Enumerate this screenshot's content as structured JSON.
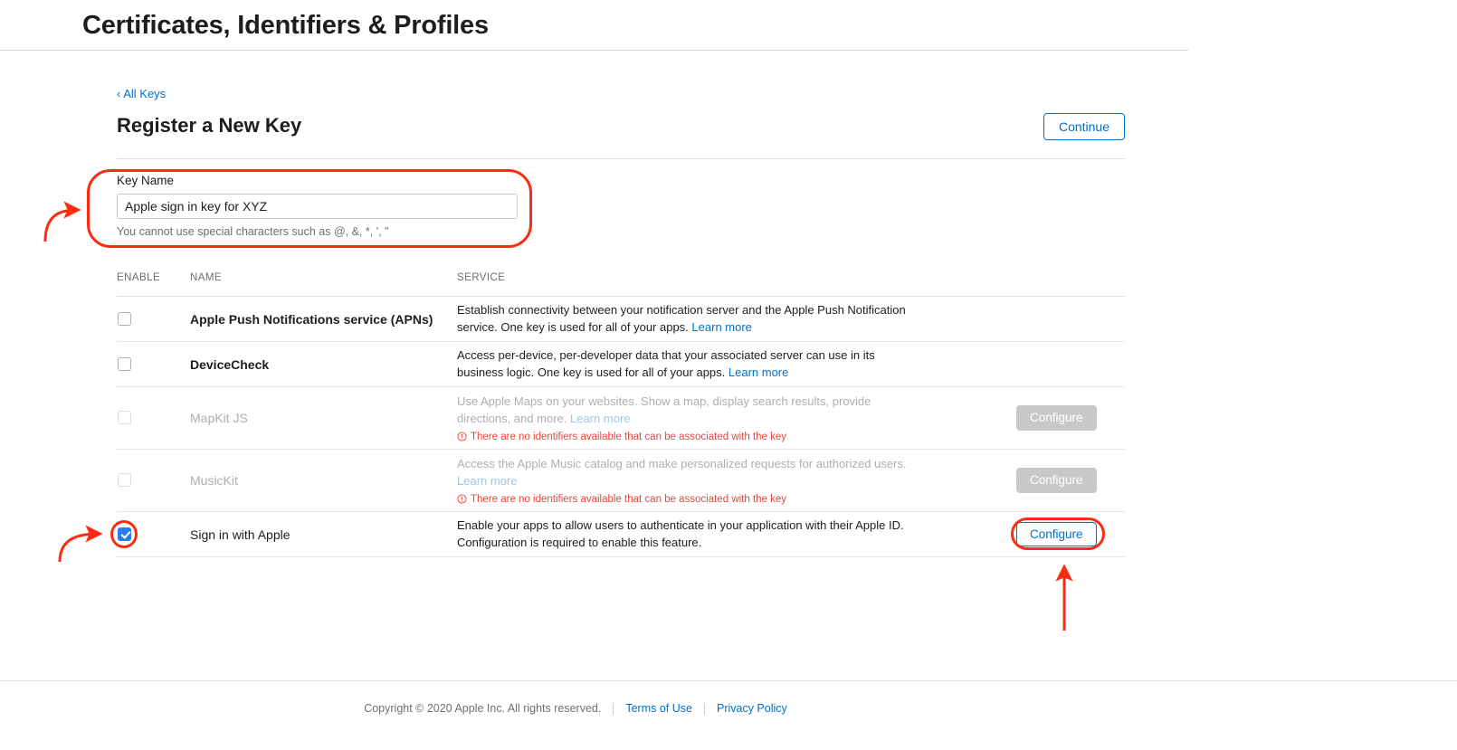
{
  "header": {
    "title": "Certificates, Identifiers & Profiles"
  },
  "breadcrumb": {
    "back_label": "‹ All Keys"
  },
  "section": {
    "title": "Register a New Key",
    "continue_label": "Continue"
  },
  "key_name": {
    "label": "Key Name",
    "value": "Apple sign in key for XYZ",
    "placeholder": "",
    "hint": "You cannot use special characters such as @, &, *, ', \""
  },
  "table": {
    "columns": {
      "enable": "ENABLE",
      "name": "NAME",
      "service": "SERVICE"
    },
    "rows": [
      {
        "name": "Apple Push Notifications service (APNs)",
        "desc": "Establish connectivity between your notification server and the Apple Push Notification service. One key is used for all of your apps.",
        "link": "Learn more",
        "warning": "",
        "action": "",
        "checked": false,
        "disabled": false
      },
      {
        "name": "DeviceCheck",
        "desc": "Access per-device, per-developer data that your associated server can use in its business logic. One key is used for all of your apps.",
        "link": "Learn more",
        "warning": "",
        "action": "",
        "checked": false,
        "disabled": false
      },
      {
        "name": "MapKit JS",
        "desc": "Use Apple Maps on your websites. Show a map, display search results, provide directions, and more.",
        "link": "Learn more",
        "warning": "There are no identifiers available that can be associated with the key",
        "action": "Configure",
        "checked": false,
        "disabled": true
      },
      {
        "name": "MusicKit",
        "desc": "Access the Apple Music catalog and make personalized requests for authorized users.",
        "link": "Learn more",
        "warning": "There are no identifiers available that can be associated with the key",
        "action": "Configure",
        "checked": false,
        "disabled": true
      },
      {
        "name": "Sign in with Apple",
        "desc": "Enable your apps to allow users to authenticate in your application with their Apple ID. Configuration is required to enable this feature.",
        "link": "",
        "warning": "",
        "action": "Configure",
        "checked": true,
        "disabled": false
      }
    ]
  },
  "footer": {
    "copyright": "Copyright © 2020 Apple Inc. All rights reserved.",
    "terms_label": "Terms of Use",
    "privacy_label": "Privacy Policy"
  },
  "annotations": {
    "color": "#ff2b10",
    "highlights": [
      "key-name-field",
      "sign-in-with-apple-checkbox",
      "sign-in-with-apple-configure-button"
    ]
  },
  "colors": {
    "accent_blue": "#0070c9",
    "checkbox_blue": "#2a7bf0",
    "warning_red": "#e8453c",
    "annotation_red": "#ff2b10",
    "disabled_gray": "#c8c8c8"
  }
}
